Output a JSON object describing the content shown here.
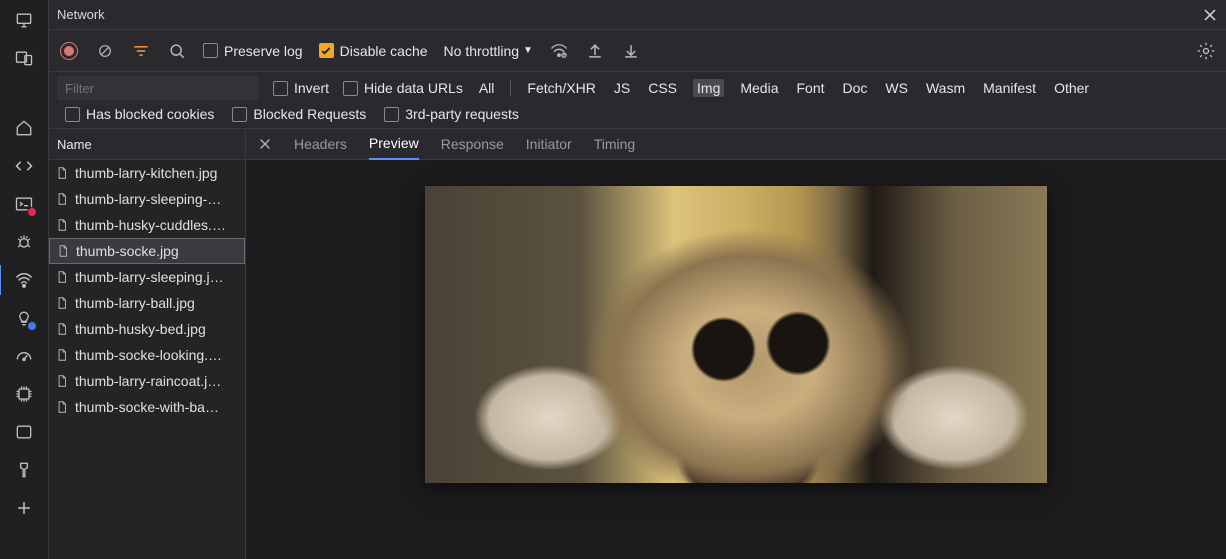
{
  "titlebar": {
    "title": "Network"
  },
  "toolbar": {
    "preserve_log_label": "Preserve log",
    "disable_cache_label": "Disable cache",
    "throttle_label": "No throttling"
  },
  "filterbar": {
    "filter_placeholder": "Filter",
    "invert_label": "Invert",
    "hide_urls_label": "Hide data URLs",
    "types": [
      "All",
      "Fetch/XHR",
      "JS",
      "CSS",
      "Img",
      "Media",
      "Font",
      "Doc",
      "WS",
      "Wasm",
      "Manifest",
      "Other"
    ],
    "types_selected": "Img",
    "has_blocked_cookies": "Has blocked cookies",
    "blocked_requests": "Blocked Requests",
    "third_party": "3rd-party requests"
  },
  "name_panel": {
    "header": "Name",
    "items": [
      "thumb-larry-kitchen.jpg",
      "thumb-larry-sleeping-…",
      "thumb-husky-cuddles.…",
      "thumb-socke.jpg",
      "thumb-larry-sleeping.j…",
      "thumb-larry-ball.jpg",
      "thumb-husky-bed.jpg",
      "thumb-socke-looking.…",
      "thumb-larry-raincoat.j…",
      "thumb-socke-with-ba…"
    ],
    "selected_index": 3
  },
  "detail_tabs": {
    "headers": "Headers",
    "preview": "Preview",
    "response": "Response",
    "initiator": "Initiator",
    "timing": "Timing",
    "active": "Preview"
  }
}
